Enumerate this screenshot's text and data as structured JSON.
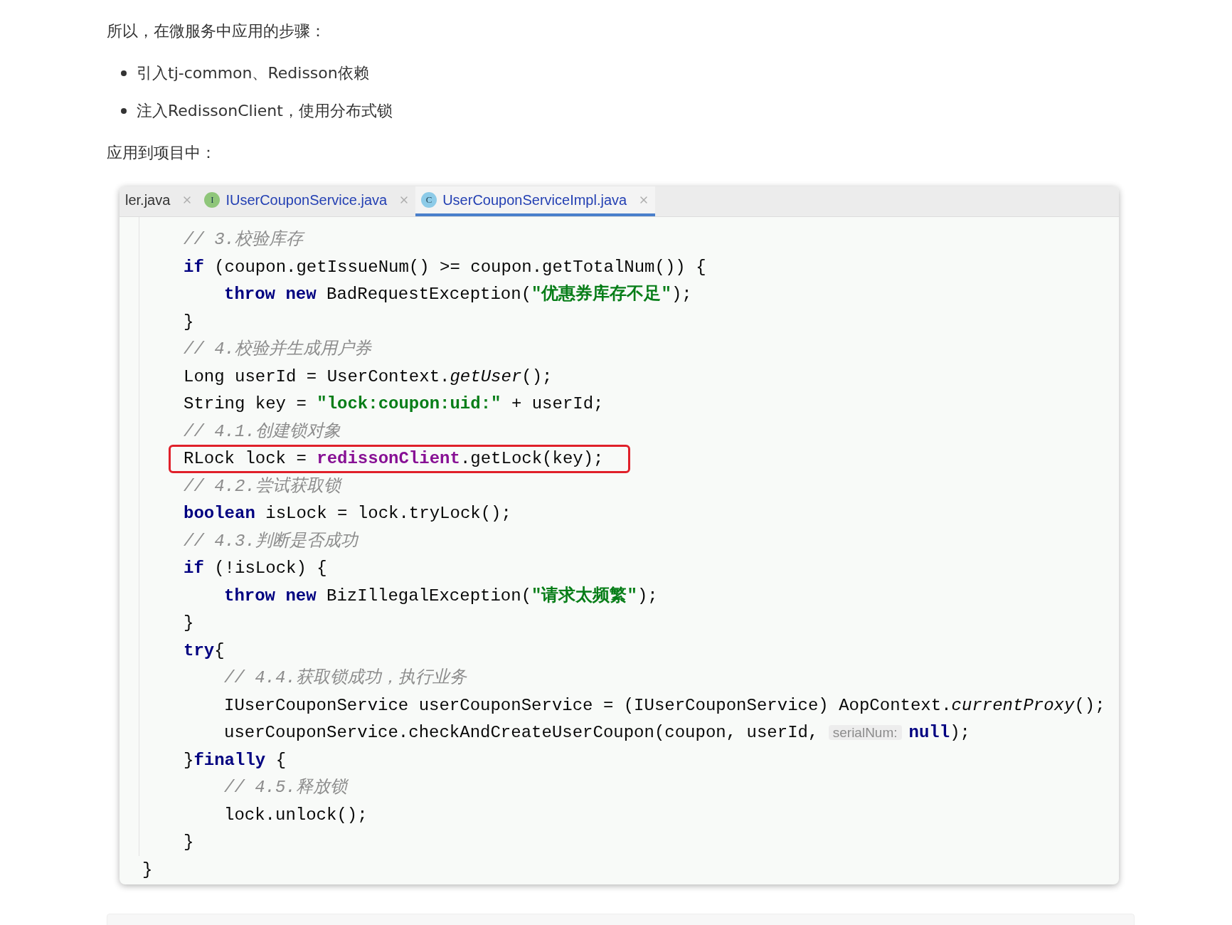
{
  "intro": "所以，在微服务中应用的步骤：",
  "steps": [
    "引入tj-common、Redisson依赖",
    "注入RedissonClient，使用分布式锁"
  ],
  "apply_label": "应用到项目中：",
  "editor": {
    "tabs": [
      {
        "label": "ler.java",
        "selected": false
      },
      {
        "label": "IUserCouponService.java",
        "icon_letter": "I",
        "color": "#8fc67a",
        "selected": false
      },
      {
        "label": "UserCouponServiceImpl.java",
        "icon_letter": "C",
        "color": "#8dcbe8",
        "selected": true
      }
    ],
    "lines": [
      {
        "kind": "block",
        "highlighted": false,
        "tokens": [
          {
            "kind": "comment",
            "text": "// 3.校验库存"
          }
        ]
      },
      {
        "kind": "block",
        "highlighted": false,
        "tokens": [
          {
            "kind": "keyword",
            "text": "if"
          },
          {
            "kind": "plain",
            "text": " (coupon.getIssueNum() >= coupon.getTotalNum()) {"
          }
        ]
      },
      {
        "kind": "nested",
        "highlighted": false,
        "tokens": [
          {
            "kind": "keyword",
            "text": "throw new"
          },
          {
            "kind": "plain",
            "text": " BadRequestException("
          },
          {
            "kind": "string",
            "text": "\"优惠券库存不足\""
          },
          {
            "kind": "plain",
            "text": ");"
          }
        ]
      },
      {
        "kind": "block",
        "highlighted": false,
        "tokens": [
          {
            "kind": "plain",
            "text": "}"
          }
        ]
      },
      {
        "kind": "block",
        "highlighted": false,
        "tokens": [
          {
            "kind": "comment",
            "text": "// 4.校验并生成用户券"
          }
        ]
      },
      {
        "kind": "block",
        "highlighted": false,
        "tokens": [
          {
            "kind": "plain",
            "text": "Long userId = UserContext."
          },
          {
            "kind": "italic",
            "text": "getUser"
          },
          {
            "kind": "plain",
            "text": "();"
          }
        ]
      },
      {
        "kind": "block",
        "highlighted": false,
        "tokens": [
          {
            "kind": "plain",
            "text": "String key = "
          },
          {
            "kind": "string",
            "text": "\"lock:coupon:uid:\""
          },
          {
            "kind": "plain",
            "text": " + userId;"
          }
        ]
      },
      {
        "kind": "block",
        "highlighted": false,
        "tokens": [
          {
            "kind": "comment",
            "text": "// 4.1.创建锁对象"
          }
        ]
      },
      {
        "kind": "block",
        "highlighted": true,
        "tokens": [
          {
            "kind": "plain",
            "text": "RLock lock = "
          },
          {
            "kind": "field",
            "text": "redissonClient"
          },
          {
            "kind": "plain",
            "text": ".getLock(key);"
          }
        ]
      },
      {
        "kind": "block",
        "highlighted": false,
        "tokens": [
          {
            "kind": "comment",
            "text": "// 4.2.尝试获取锁"
          }
        ]
      },
      {
        "kind": "block",
        "highlighted": false,
        "tokens": [
          {
            "kind": "keyword",
            "text": "boolean"
          },
          {
            "kind": "plain",
            "text": " isLock = lock.tryLock();"
          }
        ]
      },
      {
        "kind": "block",
        "highlighted": false,
        "tokens": [
          {
            "kind": "comment",
            "text": "// 4.3.判断是否成功"
          }
        ]
      },
      {
        "kind": "block",
        "highlighted": false,
        "tokens": [
          {
            "kind": "keyword",
            "text": "if"
          },
          {
            "kind": "plain",
            "text": " (!isLock) {"
          }
        ]
      },
      {
        "kind": "nested",
        "highlighted": false,
        "tokens": [
          {
            "kind": "keyword",
            "text": "throw new"
          },
          {
            "kind": "plain",
            "text": " BizIllegalException("
          },
          {
            "kind": "string",
            "text": "\"请求太频繁\""
          },
          {
            "kind": "plain",
            "text": ");"
          }
        ]
      },
      {
        "kind": "block",
        "highlighted": false,
        "tokens": [
          {
            "kind": "plain",
            "text": "}"
          }
        ]
      },
      {
        "kind": "block",
        "highlighted": false,
        "tokens": [
          {
            "kind": "keyword",
            "text": "try"
          },
          {
            "kind": "plain",
            "text": "{"
          }
        ]
      },
      {
        "kind": "nested",
        "highlighted": false,
        "tokens": [
          {
            "kind": "comment",
            "text": "// 4.4.获取锁成功，执行业务"
          }
        ]
      },
      {
        "kind": "nested",
        "highlighted": false,
        "tokens": [
          {
            "kind": "plain",
            "text": "IUserCouponService userCouponService = (IUserCouponService) AopContext."
          },
          {
            "kind": "italic",
            "text": "currentProxy"
          },
          {
            "kind": "plain",
            "text": "();"
          }
        ]
      },
      {
        "kind": "nested",
        "highlighted": false,
        "tokens": [
          {
            "kind": "plain",
            "text": "userCouponService.checkAndCreateUserCoupon(coupon, userId, "
          },
          {
            "kind": "hint",
            "text": "serialNum:"
          },
          {
            "kind": "keyword",
            "text": "null"
          },
          {
            "kind": "plain",
            "text": ");"
          }
        ]
      },
      {
        "kind": "block",
        "highlighted": false,
        "tokens": [
          {
            "kind": "plain",
            "text": "}"
          },
          {
            "kind": "keyword",
            "text": "finally"
          },
          {
            "kind": "plain",
            "text": " {"
          }
        ]
      },
      {
        "kind": "nested",
        "highlighted": false,
        "tokens": [
          {
            "kind": "comment",
            "text": "// 4.5.释放锁"
          }
        ]
      },
      {
        "kind": "nested",
        "highlighted": false,
        "tokens": [
          {
            "kind": "plain",
            "text": "lock.unlock();"
          }
        ]
      },
      {
        "kind": "block",
        "highlighted": false,
        "tokens": [
          {
            "kind": "plain",
            "text": "}"
          }
        ]
      },
      {
        "kind": "outer",
        "highlighted": false,
        "tokens": [
          {
            "kind": "plain",
            "text": "}"
          }
        ]
      }
    ]
  }
}
